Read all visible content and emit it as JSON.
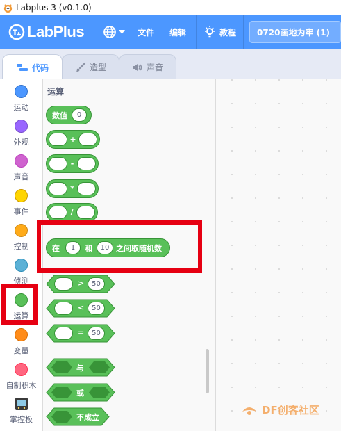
{
  "window": {
    "title": "Labplus 3 (v0.1.0)"
  },
  "menubar": {
    "logo_text": "LabPlus",
    "file": "文件",
    "edit": "编辑",
    "tutorial": "教程",
    "project_name": "0720画地为牢 (1)",
    "color": "#4c97ff"
  },
  "tabs": [
    {
      "label": "代码",
      "icon": "code-icon",
      "active": true
    },
    {
      "label": "造型",
      "icon": "brush-icon",
      "active": false
    },
    {
      "label": "声音",
      "icon": "speaker-icon",
      "active": false
    }
  ],
  "categories": [
    {
      "label": "运动",
      "color": "#4c97ff"
    },
    {
      "label": "外观",
      "color": "#9966ff"
    },
    {
      "label": "声音",
      "color": "#cf63cf"
    },
    {
      "label": "事件",
      "color": "#ffd500"
    },
    {
      "label": "控制",
      "color": "#ffab19"
    },
    {
      "label": "侦测",
      "color": "#5cb1d6"
    },
    {
      "label": "运算",
      "color": "#59c059",
      "selected": true
    },
    {
      "label": "变量",
      "color": "#ff8c1a"
    },
    {
      "label": "自制积木",
      "color": "#ff6680"
    },
    {
      "label": "掌控板",
      "icon": "board-icon"
    }
  ],
  "palette": {
    "title": "运算",
    "number_label": "数值",
    "number_value": "0",
    "ops": [
      "+",
      "-",
      "*",
      "/"
    ],
    "random": {
      "prefix": "在",
      "from": "1",
      "mid": "和",
      "to": "10",
      "suffix": "之间取随机数"
    },
    "compare": [
      {
        "op": ">",
        "value": "50"
      },
      {
        "op": "<",
        "value": "50"
      },
      {
        "op": "=",
        "value": "50"
      }
    ],
    "logic_and": "与",
    "logic_or": "或",
    "logic_not": "不成立",
    "block_color": "#59c059"
  },
  "watermark": {
    "text": "DF创客社区"
  }
}
